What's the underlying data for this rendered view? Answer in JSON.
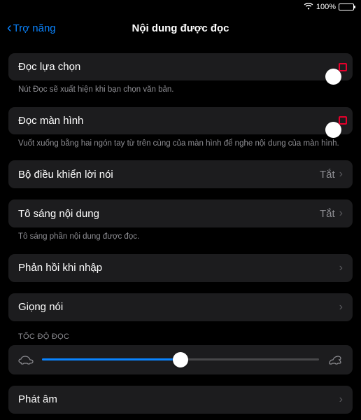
{
  "status": {
    "battery_pct": "100%"
  },
  "nav": {
    "back": "Trợ năng",
    "title": "Nội dung được đọc"
  },
  "rows": {
    "speak_selection": {
      "label": "Đọc lựa chọn",
      "desc": "Nút Đọc sẽ xuất hiện khi bạn chọn văn bản.",
      "on": true
    },
    "speak_screen": {
      "label": "Đọc màn hình",
      "desc": "Vuốt xuống bằng hai ngón tay từ trên cùng của màn hình để nghe nội dung của màn hình.",
      "on": true
    },
    "speech_controller": {
      "label": "Bộ điều khiển lời nói",
      "value": "Tắt"
    },
    "highlight_content": {
      "label": "Tô sáng nội dung",
      "value": "Tắt",
      "desc": "Tô sáng phần nội dung được đọc."
    },
    "typing_feedback": {
      "label": "Phản hồi khi nhập"
    },
    "voices": {
      "label": "Giọng nói"
    },
    "pronunciation": {
      "label": "Phát âm"
    }
  },
  "speed": {
    "header": "TỐC ĐỘ ĐỌC",
    "value_pct": 50
  }
}
